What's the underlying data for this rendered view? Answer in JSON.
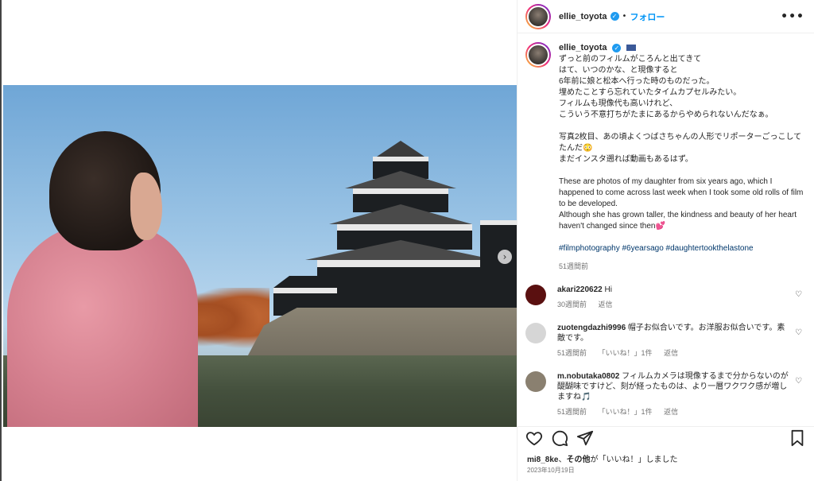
{
  "post": {
    "username": "ellie_toyota",
    "separator": "•",
    "follow_label": "フォロー",
    "more_label": "•••"
  },
  "caption": {
    "username": "ellie_toyota",
    "lines_ja1": [
      "ずっと前のフィルムがころんと出てきて",
      "はて、いつのかな、と現像すると",
      "6年前に娘と松本へ行った時のものだった。",
      "埋めたことすら忘れていたタイムカプセルみたい。",
      "フィルムも現像代も高いけれど、",
      "こういう不意打ちがたまにあるからやめられないんだなぁ。"
    ],
    "lines_ja2": [
      "写真2枚目、あの頃よくつばさちゃんの人形でリポーターごっこしてたんだ😳",
      "まだインスタ遡れば動画もあるはず。"
    ],
    "lines_en": [
      "These are photos of my daughter from six years ago, which I happened to come across last week when I took some old rolls of film to be developed.",
      "Although she has grown taller, the kindness and beauty of her heart haven't changed since then💕"
    ],
    "tags": "#filmphotography #6yearsago #daughtertookthelastone",
    "time": "51週間前"
  },
  "comments": [
    {
      "user": "akari220622",
      "text": "Hi",
      "time": "30週間前",
      "likes": "",
      "reply": "返信",
      "avatar_color": "#5a1010"
    },
    {
      "user": "zuotengdazhi9996",
      "text": "帽子お似合いです。お洋服お似合いです。素敵です。",
      "time": "51週間前",
      "likes": "「いいね！」1件",
      "reply": "返信",
      "avatar_color": "#d6d6d6"
    },
    {
      "user": "m.nobutaka0802",
      "text": "フィルムカメラは現像するまで分からないのが醍醐味ですけど、刻が経ったものは、より一層ワクワク感が増しますね🎵",
      "time": "51週間前",
      "likes": "「いいね！」1件",
      "reply": "返信",
      "avatar_color": "#8a8070"
    }
  ],
  "likes_line": {
    "user": "mi8_8ke",
    "sep": "、",
    "others": "その他",
    "suffix": "が「いいね！」しました"
  },
  "date": "2023年10月19日",
  "icons": {
    "verified": "✓",
    "heart": "♡",
    "carousel_next": "›"
  }
}
